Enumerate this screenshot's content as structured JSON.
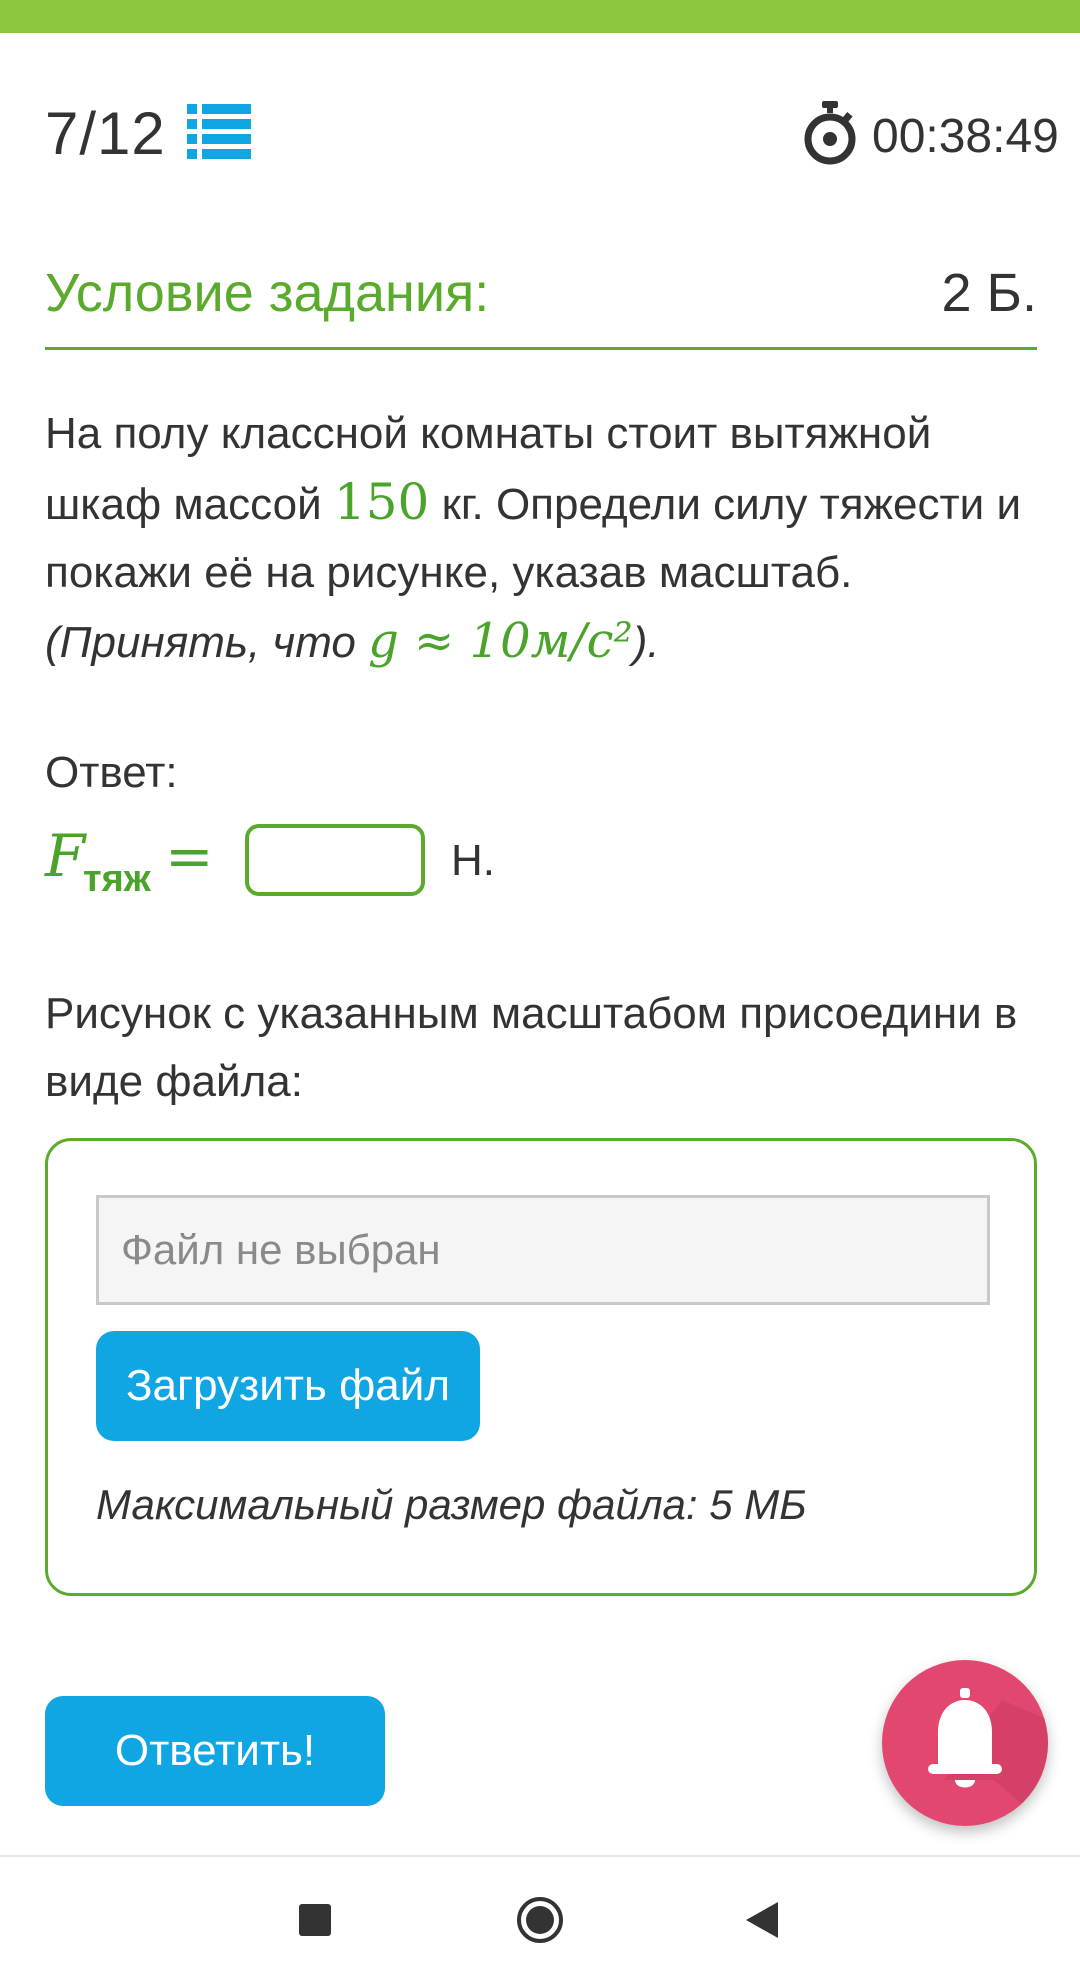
{
  "header": {
    "progress": "7/12",
    "timer": "00:38:49"
  },
  "condition": {
    "title": "Условие задания:",
    "points": "2 Б."
  },
  "problem": {
    "part1": "На полу классной комнаты стоит вытяжной шкаф массой ",
    "mass": "150",
    "part2": " кг. Определи силу тяжести и покажи её на рисунке, указав масштаб.",
    "note_open": "(Принять, что ",
    "formula": "g ≈ 10м/с²",
    "note_close": ")."
  },
  "answer": {
    "label": "Ответ:",
    "variable": "F",
    "subscript": "тяж",
    "equals": "=",
    "input_value": "",
    "unit": "Н."
  },
  "attachment": {
    "label": "Рисунок с указанным масштабом присоедини в виде файла:",
    "file_placeholder": "Файл не выбран",
    "upload_button": "Загрузить файл",
    "max_size": "Максимальный размер файла: 5 МБ"
  },
  "submit_button": "Ответить!",
  "icons": {
    "list": "list-icon",
    "timer": "stopwatch-icon",
    "bell": "bell-icon",
    "nav_recent": "square-icon",
    "nav_home": "circle-icon",
    "nav_back": "triangle-back-icon"
  },
  "colors": {
    "accent_green": "#5aaa2b",
    "top_stripe": "#8cc63f",
    "button_blue": "#0fa6e3",
    "bell_pink": "#e2476f"
  }
}
